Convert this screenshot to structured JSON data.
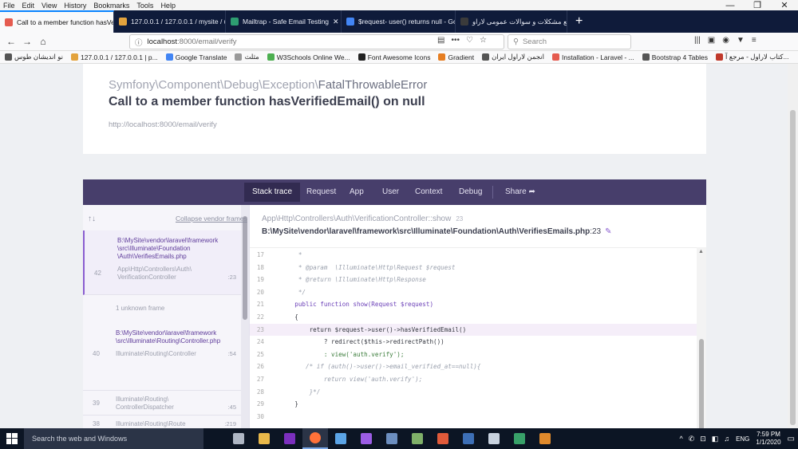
{
  "menubar": [
    "File",
    "Edit",
    "View",
    "History",
    "Bookmarks",
    "Tools",
    "Help"
  ],
  "window_controls": [
    "—",
    "❐",
    "✕"
  ],
  "tabs": [
    {
      "label": "Call to a member function hasVe",
      "active": true,
      "color": "#e55b4f"
    },
    {
      "label": "127.0.0.1 / 127.0.0.1 / mysite / u",
      "active": false,
      "color": "#e3a33d"
    },
    {
      "label": "Mailtrap - Safe Email Testing",
      "active": false,
      "color": "#2e9e71"
    },
    {
      "label": "$request- user() returns null - Go",
      "active": false,
      "color": "#4285f4"
    },
    {
      "label": "رفع مشکلات و سوالات عمومی لاراو",
      "active": false,
      "color": "#3b3b3b"
    }
  ],
  "newtab_label": "+",
  "nav": {
    "back": "←",
    "forward": "→",
    "home": "⌂",
    "url_host": "localhost",
    "url_path": ":8000/email/verify",
    "info_icon": "ⓘ",
    "url_icons": [
      "▤",
      "•••",
      "♡",
      "☆"
    ],
    "search_placeholder": "Search",
    "right_icons": [
      "|||",
      "▣",
      "◉",
      "▼",
      "≡"
    ]
  },
  "bookmarks": [
    {
      "label": "نو اندیشان طوس",
      "color": "#555"
    },
    {
      "label": "127.0.0.1 / 127.0.0.1 | p...",
      "color": "#e3a33d"
    },
    {
      "label": "Google Translate",
      "color": "#4285f4"
    },
    {
      "label": "مثلث",
      "color": "#999"
    },
    {
      "label": "W3Schools Online We...",
      "color": "#4caf50"
    },
    {
      "label": "Font Awesome Icons",
      "color": "#222"
    },
    {
      "label": "Gradient",
      "color": "#e67e22"
    },
    {
      "label": "انجمن لاراول ایران",
      "color": "#555"
    },
    {
      "label": "Installation - Laravel - ...",
      "color": "#e55b4f"
    },
    {
      "label": "Bootstrap 4 Tables",
      "color": "#555"
    },
    {
      "label": "کتاب لاراول - مرجع آ...",
      "color": "#c0392b"
    }
  ],
  "exception": {
    "class_prefix": "Symfony\\Component\\Debug\\Exception\\",
    "class_last": "FatalThrowableError",
    "message": "Call to a member function hasVerifiedEmail() on null",
    "url": "http://localhost:8000/email/verify"
  },
  "stack_tabs": [
    "Stack trace",
    "Request",
    "App",
    "User",
    "Context",
    "Debug",
    "Share"
  ],
  "share_icon": "➦",
  "sort_arrows": "↑↓",
  "collapse_label": "Collapse vendor frames",
  "frames": [
    {
      "line": "42",
      "path": "B:\\MySite\\vendor\\laravel\\framework\n\\src\\Illuminate\\Foundation\n\\Auth\\VerifiesEmails.php",
      "cls": "App\\Http\\Controllers\\Auth\\\nVerificationController",
      "num": ":23",
      "selected": true
    },
    {
      "line": "40",
      "path": "B:\\MySite\\vendor\\laravel\\framework\n\\src\\Illuminate\\Routing\\Controller.php",
      "cls": "Illuminate\\Routing\\Controller",
      "num": ":54",
      "selected": false
    },
    {
      "line": "39",
      "path": "",
      "cls": "Illuminate\\Routing\\\nControllerDispatcher",
      "num": ":45",
      "selected": false
    },
    {
      "line": "38",
      "path": "",
      "cls": "Illuminate\\Routing\\Route",
      "num": ":219",
      "selected": false
    }
  ],
  "unknown_frame": "1 unknown frame",
  "code_header": {
    "cls": "App\\Http\\Controllers\\Auth\\VerificationController::show",
    "cls_num": "23",
    "file": "B:\\MySite\\vendor\\laravel\\framework\\src\\Illuminate\\Foundation\\Auth\\VerifiesEmails.php",
    "file_line": ":23",
    "pencil": "✎"
  },
  "code_lines": [
    {
      "no": "17",
      "text": "     *",
      "kind": "cm"
    },
    {
      "no": "18",
      "text": "     * @param  \\Illuminate\\Http\\Request $request",
      "kind": "cm"
    },
    {
      "no": "19",
      "text": "     * @return \\Illuminate\\Http\\Response",
      "kind": "cm"
    },
    {
      "no": "20",
      "text": "     */",
      "kind": "cm"
    },
    {
      "no": "21",
      "text": "    public function show(Request $request)",
      "kind": "kw"
    },
    {
      "no": "22",
      "text": "    {",
      "kind": ""
    },
    {
      "no": "23",
      "text": "        return $request->user()->hasVerifiedEmail()",
      "kind": "hl"
    },
    {
      "no": "24",
      "text": "            ? redirect($this->redirectPath())",
      "kind": ""
    },
    {
      "no": "25",
      "text": "            : view('auth.verify');",
      "kind": "st"
    },
    {
      "no": "26",
      "text": "       /* if (auth()->user()->email_verified_at==null){",
      "kind": "cm"
    },
    {
      "no": "27",
      "text": "            return view('auth.verify');",
      "kind": "cm"
    },
    {
      "no": "28",
      "text": "        }*/",
      "kind": "cm"
    },
    {
      "no": "29",
      "text": "    }",
      "kind": ""
    },
    {
      "no": "30",
      "text": "",
      "kind": ""
    }
  ],
  "taskbar": {
    "search": "Search the web and Windows",
    "icons": [
      "#aeb6c4",
      "#e8b84a",
      "#7b2fbe",
      "#ff7139",
      "#5ba4e6",
      "#9b5de5",
      "#6c8ebf",
      "#7fb069",
      "#e05a3a",
      "#3d6fb6",
      "#c8d2df",
      "#38a169",
      "#e08a2c"
    ],
    "lang": "ENG",
    "time": "7:59 PM",
    "date": "1/1/2020",
    "tray_icons": [
      "^",
      "✆",
      "⊡",
      "◧",
      "♫"
    ],
    "notif": "▭"
  }
}
